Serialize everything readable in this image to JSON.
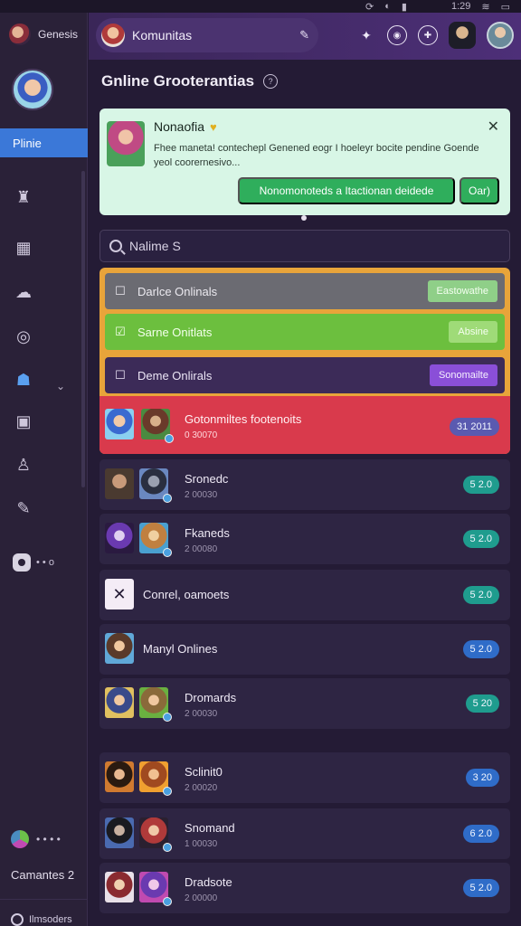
{
  "status_bar": {
    "time": "1:29",
    "icons": [
      "sync-icon",
      "moon-icon",
      "signal-icon",
      "wifi-icon",
      "battery-icon"
    ]
  },
  "sidebar": {
    "top_label": "Genesis",
    "active_item": "Plinie",
    "user_label": "• • • •",
    "toggle_label": "• • o",
    "count_label": "Camantes 2",
    "footer_label": "Ilmsoders"
  },
  "topbar": {
    "title": "Komunitas"
  },
  "main": {
    "page_title": "Gnline Grooterantias",
    "notice": {
      "title": "Nonaofia",
      "body": "Fhee maneta! contechepl Genened eogr I hoeleyr bocite pendine Goende yeol coorernesivo...",
      "primary_button": "Nonomonoteds a Itactionan deidede",
      "secondary_button": "Oar)"
    },
    "search": {
      "value": "Nalime S"
    },
    "filters": [
      {
        "label": "Darlce Onlinals",
        "action": "Eastowathe"
      },
      {
        "label": "Sarne Onitlats",
        "action": "Absine"
      },
      {
        "label": "Deme Onlirals",
        "action": "Sonomailte"
      }
    ],
    "highlight": {
      "title": "Gotonmiltes footenoits",
      "sub": "0 30070",
      "score": "31 2011"
    },
    "list": [
      {
        "title": "Sronedc",
        "sub": "2 00030",
        "score": "5 2.0"
      },
      {
        "title": "Fkaneds",
        "sub": "2 00080",
        "score": "5 2.0"
      },
      {
        "title": "Conrel, oamoets",
        "sub": "",
        "score": "5 2.0"
      },
      {
        "title": "Manyl Onlines",
        "sub": "",
        "score": "5 2.0"
      },
      {
        "title": "Dromards",
        "sub": "2 00030",
        "score": "5 20"
      },
      {
        "title": "Sclinit0",
        "sub": "2 00020",
        "score": "3 20"
      },
      {
        "title": "Snomand",
        "sub": "1 00030",
        "score": "6 2.0"
      },
      {
        "title": "Dradsote",
        "sub": "2 00000",
        "score": "5 2.0"
      }
    ]
  },
  "colors": {
    "accent_blue": "#3b78d8",
    "notice_bg": "#d8f6e6",
    "green_button": "#2fae5c",
    "highlight_red": "#d93a4c",
    "panel_orange": "#e8a43a"
  }
}
